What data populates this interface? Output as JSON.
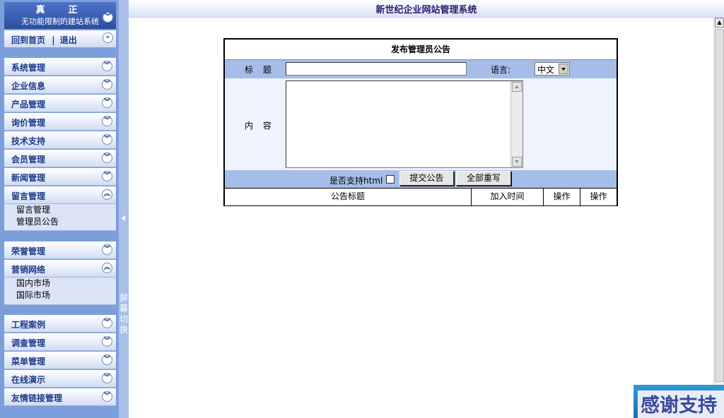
{
  "brand": {
    "line1": "真　正",
    "line2": "无功能限制的建站系统"
  },
  "home": {
    "home_label": "回到首页",
    "sep": "|",
    "logout_label": "退出"
  },
  "menu": [
    {
      "label": "系统管理"
    },
    {
      "label": "企业信息"
    },
    {
      "label": "产品管理"
    },
    {
      "label": "询价管理"
    },
    {
      "label": "技术支持"
    },
    {
      "label": "会员管理"
    },
    {
      "label": "新闻管理"
    },
    {
      "label": "留言管理",
      "expanded": true,
      "children": [
        "留言管理",
        "管理员公告"
      ]
    },
    {
      "label": "荣誉管理"
    },
    {
      "label": "营销网络",
      "expanded": true,
      "children": [
        "国内市场",
        "国际市场"
      ]
    },
    {
      "label": "工程案例"
    },
    {
      "label": "调查管理"
    },
    {
      "label": "菜单管理"
    },
    {
      "label": "在线演示"
    },
    {
      "label": "友情链接管理"
    }
  ],
  "splitter": {
    "label": "屏幕切换"
  },
  "header": {
    "title": "新世纪企业网站管理系统"
  },
  "form": {
    "heading": "发布管理员公告",
    "title_label": "标 题",
    "title_value": "",
    "language_label": "语言:",
    "language_value": "中文",
    "content_label": "内 容",
    "content_value": "",
    "html_label": "是否支持html",
    "html_checked": false,
    "submit_label": "提交公告",
    "reset_label": "全部重写"
  },
  "table": {
    "columns": [
      "公告标题",
      "加入时间",
      "操作",
      "操作"
    ]
  },
  "badge": {
    "text": "感谢支持"
  },
  "icons": {
    "expand": "double-chevron-down-icon",
    "collapse": "double-chevron-up-icon",
    "back": "double-chevron-left-icon"
  },
  "colors": {
    "sidebar": "#7c9fdc",
    "accent": "#a5bde8",
    "title": "#2a1a6e"
  }
}
